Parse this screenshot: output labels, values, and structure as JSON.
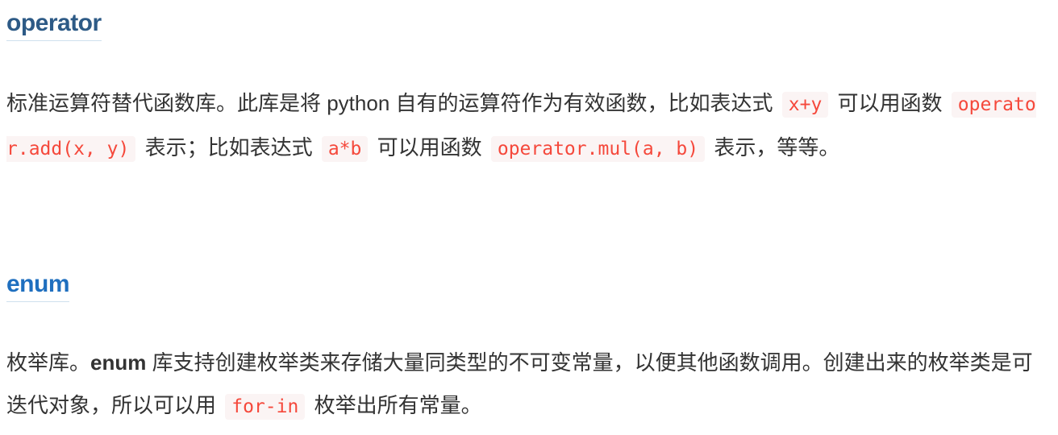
{
  "operator_section": {
    "title": "operator",
    "text_1": "标准运算符替代函数库。此库是将 python 自有的运算符作为有效函数，比如表达式",
    "code_1": "x+y",
    "text_2": "可以用函数",
    "code_2": "operator.add(x, y)",
    "text_3": "表示；比如表达式",
    "code_3": "a*b",
    "text_4": "可以用函数",
    "code_4": "operator.mul(a, b)",
    "text_5": "表示，等等。"
  },
  "enum_section": {
    "title": "enum",
    "text_1": "枚举库。",
    "bold_1": "enum",
    "text_2": "库支持创建枚举类来存储大量同类型的不可变常量，以便其他函数调用。创建出来的枚举类是可迭代对象，所以可以用",
    "code_1": "for-in",
    "text_3": "枚举出所有常量。"
  }
}
